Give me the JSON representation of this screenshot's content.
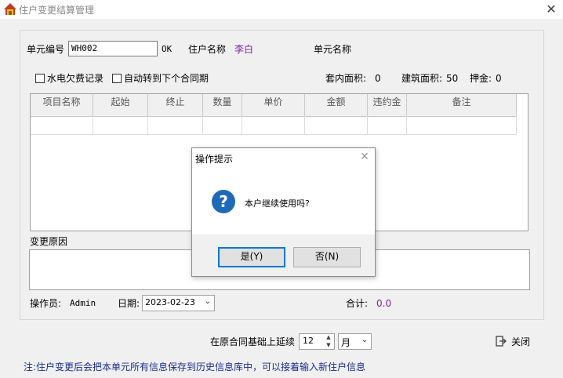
{
  "window": {
    "title": "住户变更结算管理",
    "close_glyph": "✕"
  },
  "header": {
    "unit_no_label": "单元编号",
    "unit_no_value": "WH002",
    "ok_text": "OK",
    "resident_label": "住户名称",
    "resident_value": "李白",
    "unit_name_label": "单元名称"
  },
  "options": {
    "utility_debt_label": "水电欠费记录",
    "auto_transfer_label": "自动转到下个合同期",
    "inner_area_label": "套内面积:",
    "inner_area_value": "0",
    "build_area_label": "建筑面积:",
    "build_area_value": "50",
    "deposit_label": "押金:",
    "deposit_value": "0"
  },
  "table": {
    "columns": [
      "项目名称",
      "起始",
      "终止",
      "数量",
      "单价",
      "金额",
      "违约金",
      "备注"
    ]
  },
  "reason": {
    "label": "变更原因"
  },
  "footer": {
    "operator_label": "操作员:",
    "operator_value": "Admin",
    "date_label": "日期:",
    "date_value": "2023-02-23",
    "total_label": "合计:",
    "total_value": "0.0",
    "total_color": "#7a1fa0",
    "extend_label": "在原合同基础上延续",
    "extend_value": "12",
    "extend_unit": "月",
    "close_label": "关闭",
    "note": "注:住户变更后会把本单元所有信息保存到历史信息库中，可以接着输入新住户信息"
  },
  "dialog": {
    "title": "操作提示",
    "icon": "question-icon",
    "message": "本户继续使用吗?",
    "yes_label": "是(Y)",
    "no_label": "否(N)",
    "close_glyph": "✕"
  },
  "colors": {
    "resident_name": "#7a1fa0",
    "note_text": "#1a2d8f",
    "question_icon": "#1f6ab8",
    "default_button_border": "#0078d7"
  }
}
